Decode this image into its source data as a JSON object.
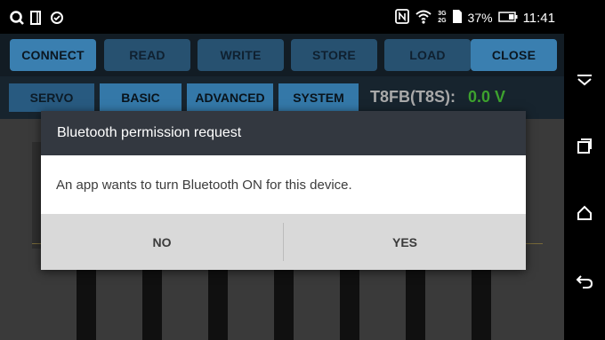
{
  "status_bar": {
    "left_icons": [
      "search-icon",
      "tablet-icon",
      "sync-icon"
    ],
    "right_icons": [
      "nfc-icon",
      "wifi-icon",
      "signal-icon",
      "sim-icon"
    ],
    "signal_label_top": "3G",
    "signal_label_bottom": "2G",
    "battery": "37%",
    "time": "11:41"
  },
  "toolbar": {
    "buttons": [
      {
        "label": "CONNECT",
        "active": true
      },
      {
        "label": "READ",
        "active": false
      },
      {
        "label": "WRITE",
        "active": false
      },
      {
        "label": "STORE",
        "active": false
      },
      {
        "label": "LOAD",
        "active": false
      },
      {
        "label": "CLOSE",
        "active": true
      }
    ]
  },
  "tabs": {
    "items": [
      {
        "label": "SERVO",
        "active": false
      },
      {
        "label": "BASIC",
        "active": true
      },
      {
        "label": "ADVANCED",
        "active": true
      },
      {
        "label": "SYSTEM",
        "active": true
      }
    ],
    "model": "T8FB(T8S):",
    "voltage": "0.0 V"
  },
  "dialog": {
    "title": "Bluetooth permission request",
    "message": "An app wants to turn Bluetooth ON for this device.",
    "no_label": "NO",
    "yes_label": "YES"
  },
  "nav_bar": {
    "icons": [
      "collapse-icon",
      "recents-icon",
      "home-icon",
      "back-icon"
    ]
  },
  "colors": {
    "button_blue": "#2d5f83",
    "dialog_title_bg": "#333840",
    "voltage_green": "#3da12e"
  }
}
